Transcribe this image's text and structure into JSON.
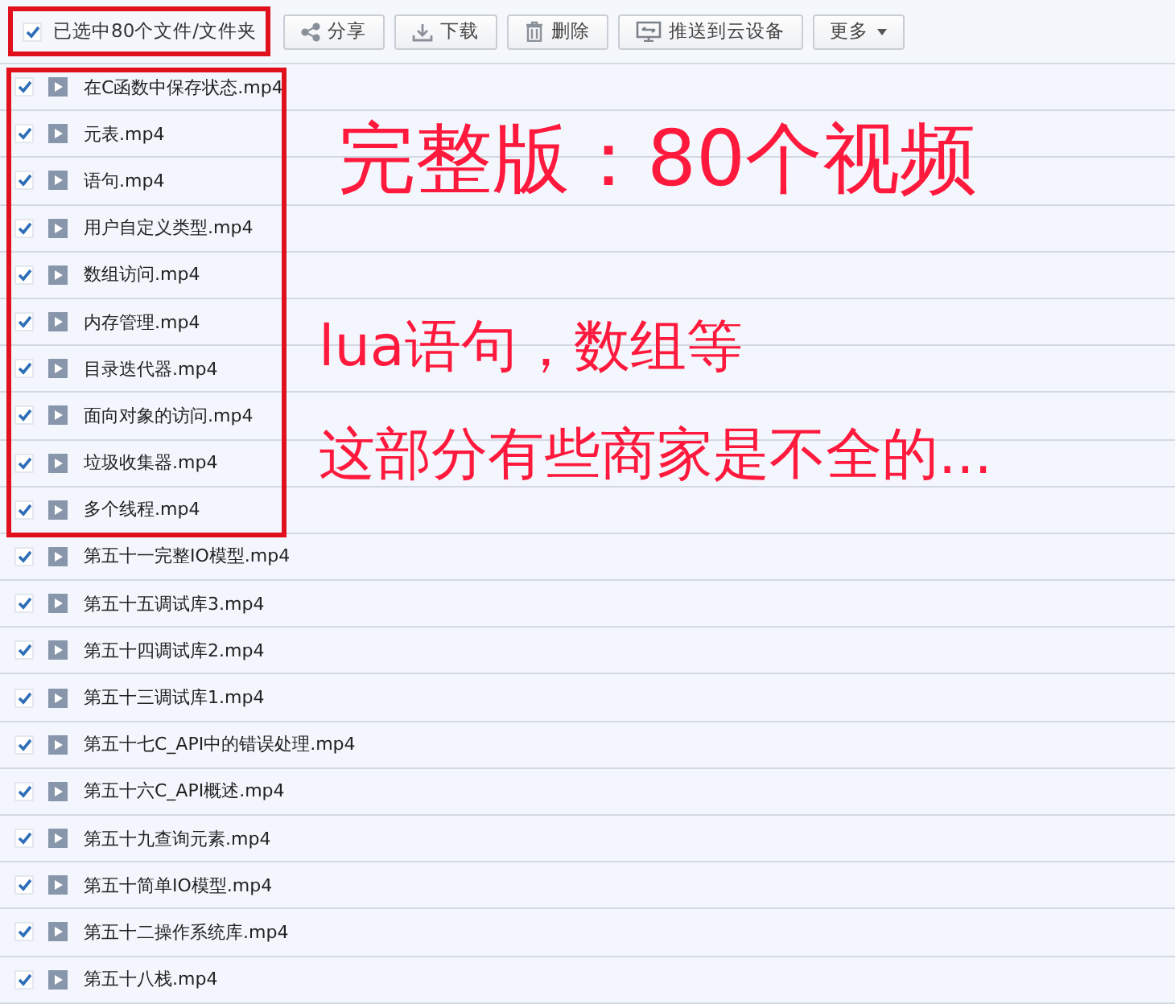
{
  "toolbar": {
    "select_all": {
      "label": "已选中80个文件/文件夹",
      "checked": true,
      "outlined": true
    },
    "buttons": [
      {
        "kind": "share",
        "label": "分享"
      },
      {
        "kind": "download",
        "label": "下载"
      },
      {
        "kind": "delete",
        "label": "删除"
      },
      {
        "kind": "push",
        "label": "推送到云设备"
      },
      {
        "kind": "more",
        "label": "更多"
      }
    ]
  },
  "file_groups": [
    {
      "outlined": true,
      "files": [
        {
          "name": "在C函数中保存状态.mp4",
          "checked": true
        },
        {
          "name": "元表.mp4",
          "checked": true
        },
        {
          "name": "语句.mp4",
          "checked": true
        },
        {
          "name": "用户自定义类型.mp4",
          "checked": true
        },
        {
          "name": "数组访问.mp4",
          "checked": true
        },
        {
          "name": "内存管理.mp4",
          "checked": true
        },
        {
          "name": "目录迭代器.mp4",
          "checked": true
        },
        {
          "name": "面向对象的访问.mp4",
          "checked": true
        },
        {
          "name": "垃圾收集器.mp4",
          "checked": true
        },
        {
          "name": "多个线程.mp4",
          "checked": true
        }
      ]
    },
    {
      "files": [
        {
          "name": "第五十一完整IO模型.mp4",
          "checked": true
        },
        {
          "name": "第五十五调试库3.mp4",
          "checked": true
        },
        {
          "name": "第五十四调试库2.mp4",
          "checked": true
        },
        {
          "name": "第五十三调试库1.mp4",
          "checked": true
        },
        {
          "name": "第五十七C_API中的错误处理.mp4",
          "checked": true
        },
        {
          "name": "第五十六C_API概述.mp4",
          "checked": true
        },
        {
          "name": "第五十九查询元素.mp4",
          "checked": true
        },
        {
          "name": "第五十简单IO模型.mp4",
          "checked": true
        },
        {
          "name": "第五十二操作系统库.mp4",
          "checked": true
        },
        {
          "name": "第五十八栈.mp4",
          "checked": true
        }
      ]
    }
  ],
  "annotations": [
    {
      "kind": "title",
      "text": "完整版：80个视频"
    },
    {
      "kind": "note",
      "text": "lua语句，数组等"
    },
    {
      "kind": "note",
      "text": "这部分有些商家是不全的..."
    }
  ]
}
